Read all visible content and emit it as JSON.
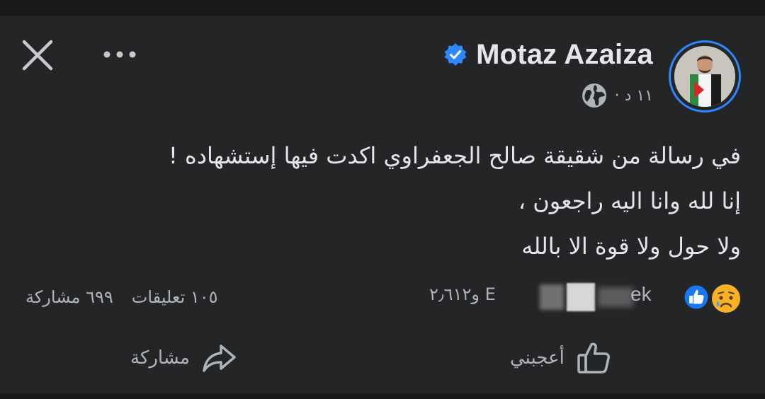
{
  "post": {
    "author_name": "Motaz Azaiza",
    "time": "١١ د ·",
    "text_lines": [
      "في رسالة من شقيقة صالح الجعفراوي اكدت فيها إستشهاده !",
      "إنا لله وانا اليه راجعون ،",
      "ولا حول ولا قوة الا بالله"
    ]
  },
  "stats": {
    "reactions_count": "E و٢٫٦١٢",
    "reactor_name_fragment": "ek",
    "comments": "١٠٥ تعليقات",
    "shares": "٦٩٩ مشاركة"
  },
  "actions": {
    "like_label": "أعجبني",
    "share_label": "مشاركة"
  },
  "icons": {
    "close": "close-icon",
    "more": "more-horizontal-icon",
    "verified": "verified-badge-icon",
    "privacy": "globe-icon",
    "like_reaction": "like-reaction-icon",
    "sad_reaction": "sad-reaction-icon",
    "like_action": "thumbs-up-icon",
    "share_action": "share-arrow-icon"
  },
  "colors": {
    "background": "#242526",
    "text": "#e4e6eb",
    "secondary_text": "#b0b3b8",
    "accent_blue": "#2d88ff",
    "reaction_yellow": "#f7b125"
  }
}
